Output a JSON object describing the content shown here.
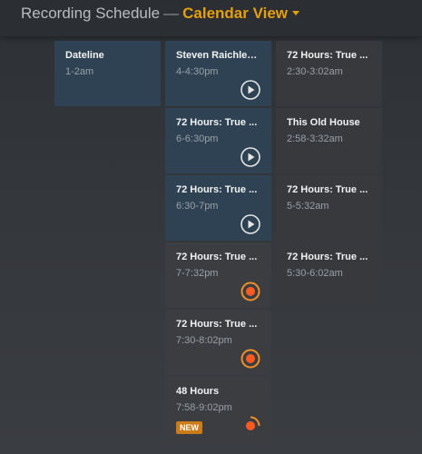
{
  "header": {
    "title": "Recording Schedule",
    "separator": "—",
    "view_label": "Calendar View"
  },
  "columns": [
    {
      "cards": [
        {
          "title": "Dateline",
          "time": "1-2am",
          "style": "blue",
          "icon": "none"
        }
      ]
    },
    {
      "cards": [
        {
          "title": "Steven Raichlen...",
          "time": "4-4:30pm",
          "style": "blue",
          "icon": "play-icon"
        },
        {
          "title": "72 Hours: True ...",
          "time": "6-6:30pm",
          "style": "blue",
          "icon": "play-icon"
        },
        {
          "title": "72 Hours: True ...",
          "time": "6:30-7pm",
          "style": "blue",
          "icon": "play-icon"
        },
        {
          "title": "72 Hours: True ...",
          "time": "7-7:32pm",
          "style": "dark",
          "icon": "record-scheduled-icon"
        },
        {
          "title": "72 Hours: True ...",
          "time": "7:30-8:02pm",
          "style": "dark",
          "icon": "record-scheduled-icon"
        },
        {
          "title": "48 Hours",
          "time": "7:58-9:02pm",
          "style": "dark",
          "icon": "recording-in-progress-icon",
          "badge": "NEW"
        }
      ]
    },
    {
      "cards": [
        {
          "title": "72 Hours: True ...",
          "time": "2:30-3:02am",
          "style": "plain",
          "icon": "none"
        },
        {
          "title": "This Old House",
          "time": "2:58-3:32am",
          "style": "plain",
          "icon": "none"
        },
        {
          "title": "72 Hours: True ...",
          "time": "5-5:32am",
          "style": "plain",
          "icon": "none"
        },
        {
          "title": "72 Hours: True ...",
          "time": "5:30-6:02am",
          "style": "plain",
          "icon": "none"
        }
      ]
    }
  ],
  "colors": {
    "accent": "#e5a00d",
    "record": "#ff5a1f",
    "record_ring": "#f0902a",
    "card_blue": "#2e4253",
    "card_dark": "#3b3d41"
  }
}
